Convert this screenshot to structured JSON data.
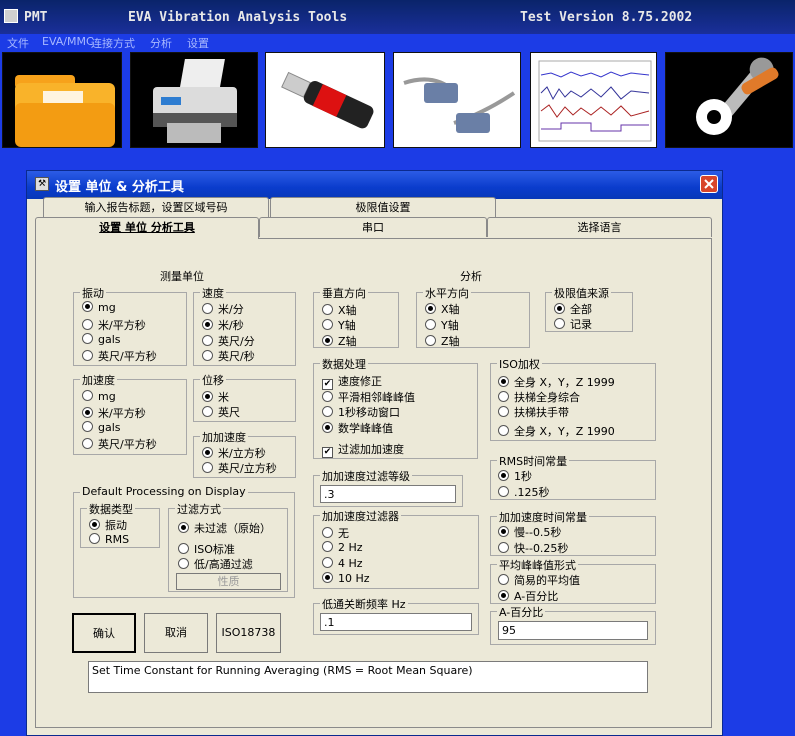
{
  "app": {
    "title_left": "PMT",
    "title_center": "EVA Vibration Analysis Tools",
    "title_right": "Test Version 8.75.2002"
  },
  "menu": [
    "文件",
    "EVA/MMC",
    "连接方式",
    "分析",
    "设置"
  ],
  "toolbar_icons": [
    "folder-icon",
    "printer-icon",
    "usb-drive-icon",
    "serial-cable-icon",
    "waveform-chart-icon",
    "settings-tools-icon"
  ],
  "dialog": {
    "title": "设置   单位 & 分析工具",
    "tabs_row1": [
      "输入报告标题，设置区域号码",
      "极限值设置"
    ],
    "tabs_row2": [
      "设置 单位 分析工具",
      "串口",
      "选择语言"
    ],
    "measure_units": {
      "header": "测量单位",
      "vibration": {
        "label": "振动",
        "options": [
          "mg",
          "米/平方秒",
          "gals",
          "英尺/平方秒"
        ],
        "selected": 0
      },
      "velocity": {
        "label": "速度",
        "options": [
          "米/分",
          "米/秒",
          "英尺/分",
          "英尺/秒"
        ],
        "selected": 1
      },
      "acceleration": {
        "label": "加速度",
        "options": [
          "mg",
          "米/平方秒",
          "gals",
          "英尺/平方秒"
        ],
        "selected": 1
      },
      "displacement": {
        "label": "位移",
        "options": [
          "米",
          "英尺"
        ],
        "selected": 0
      },
      "jerk": {
        "label": "加加速度",
        "options": [
          "米/立方秒",
          "英尺/立方秒"
        ],
        "selected": 0
      }
    },
    "default_processing": {
      "label": "Default Processing on Display",
      "data_type": {
        "label": "数据类型",
        "options": [
          "振动",
          "RMS"
        ],
        "selected": 0
      },
      "filter_mode": {
        "label": "过滤方式",
        "options": [
          "未过滤（原始）",
          "ISO标准",
          "低/高通过滤"
        ],
        "selected": 0
      },
      "properties_button": "性质"
    },
    "analysis": {
      "header": "分析",
      "vertical": {
        "label": "垂直方向",
        "options": [
          "X轴",
          "Y轴",
          "Z轴"
        ],
        "selected": 2
      },
      "horizontal": {
        "label": "水平方向",
        "options": [
          "X轴",
          "Y轴",
          "Z轴"
        ],
        "selected": 0
      },
      "limit_source": {
        "label": "极限值来源",
        "options": [
          "全部",
          "记录"
        ],
        "selected": 0
      },
      "data_processing": {
        "label": "数据处理",
        "options": [
          "速度修正",
          "平滑相邻峰峰值",
          "1秒移动窗口",
          "数学峰峰值"
        ],
        "type": [
          "check",
          "radio",
          "radio",
          "radio"
        ],
        "checked": [
          true,
          false,
          false,
          true
        ],
        "filter_jerk": {
          "label": "过滤加加速度",
          "checked": true
        }
      },
      "jerk_filter_level": {
        "label": "加加速度过滤等级",
        "value": ".3"
      },
      "jerk_filter": {
        "label": "加加速度过滤器",
        "options": [
          "无",
          "2 Hz",
          "4 Hz",
          "10 Hz"
        ],
        "selected": 3
      },
      "lowpass": {
        "label": "低通关断频率 Hz",
        "value": ".1"
      },
      "iso_weight": {
        "label": "ISO加权",
        "options": [
          "全身 X，Y，Z 1999",
          "扶梯全身综合",
          "扶梯扶手带",
          "全身 X，Y，Z 1990"
        ],
        "selected": 0
      },
      "rms_time": {
        "label": "RMS时间常量",
        "options": [
          "1秒",
          ".125秒"
        ],
        "selected": 0
      },
      "jerk_time": {
        "label": "加加速度时间常量",
        "options": [
          "慢--0.5秒",
          "快--0.25秒"
        ],
        "selected": 0
      },
      "avg_peak": {
        "label": "平均峰峰值形式",
        "options": [
          "简易的平均值",
          "A-百分比"
        ],
        "selected": 1
      },
      "a_percent": {
        "label": "A-百分比",
        "value": "95"
      }
    },
    "buttons": {
      "ok": "确认",
      "cancel": "取消",
      "iso": "ISO18738"
    },
    "status_text": "Set Time Constant for Running Averaging (RMS = Root Mean Square)"
  },
  "colors": {
    "desktop": "#1c3ce6",
    "dialog_bg": "#ece9d8",
    "title_bar": "#0a3ccc",
    "close_btn": "#d8452b"
  }
}
